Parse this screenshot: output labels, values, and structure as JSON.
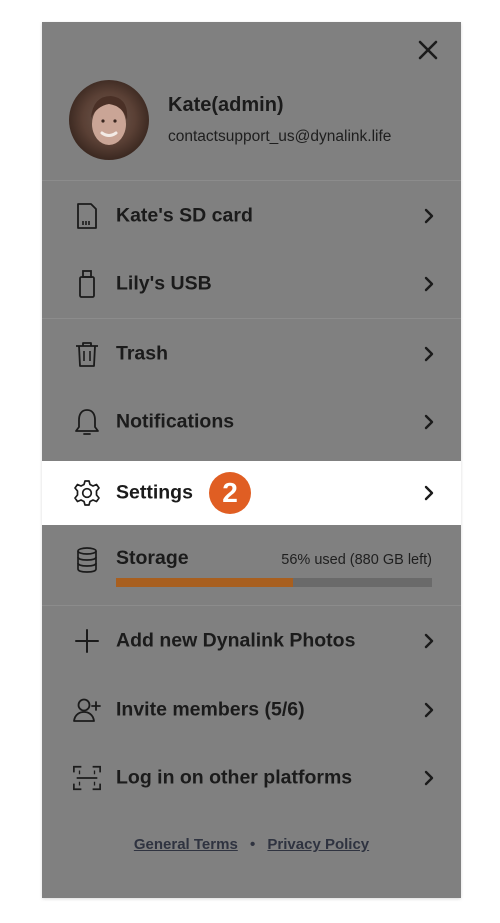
{
  "profile": {
    "name": "Kate(admin)",
    "email": "contactsupport_us@dynalink.life"
  },
  "devices": [
    {
      "label": "Kate's SD card",
      "icon": "sd-card-icon"
    },
    {
      "label": "Lily's USB",
      "icon": "usb-icon"
    }
  ],
  "menu": [
    {
      "label": "Trash",
      "icon": "trash-icon"
    },
    {
      "label": "Notifications",
      "icon": "bell-icon"
    }
  ],
  "settings": {
    "label": "Settings",
    "icon": "gear-icon",
    "step_badge": "2"
  },
  "storage": {
    "label": "Storage",
    "usage_text": "56% used (880 GB left)",
    "used_fraction": 0.56,
    "icon": "database-icon"
  },
  "actions": [
    {
      "label": "Add new Dynalink Photos",
      "icon": "plus-icon"
    },
    {
      "label": "Invite members (5/6)",
      "icon": "add-user-icon"
    },
    {
      "label": "Log in on other platforms",
      "icon": "scan-icon"
    }
  ],
  "footer": {
    "terms": "General Terms",
    "separator": "•",
    "privacy": "Privacy Policy"
  },
  "colors": {
    "overlay": "#808080",
    "highlight": "#ffffff",
    "badge": "#e05e23",
    "storage_bar": "#a85f1f",
    "text": "#1b1b1b"
  }
}
